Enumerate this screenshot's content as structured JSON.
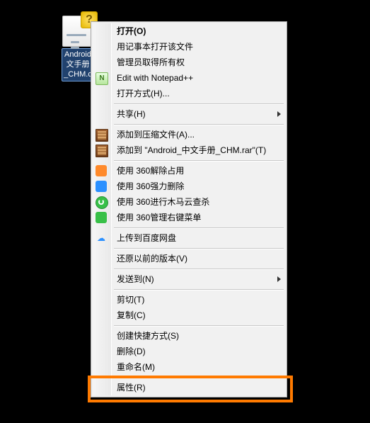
{
  "file": {
    "name_line1": "Android",
    "name_line2": "文手册",
    "name_line3": "_CHM.c"
  },
  "menu": {
    "open": "打开(O)",
    "open_notepad": "用记事本打开该文件",
    "take_ownership": "管理员取得所有权",
    "edit_npp": "Edit with Notepad++",
    "open_with": "打开方式(H)...",
    "share": "共享(H)",
    "add_to_archive": "添加到压缩文件(A)...",
    "add_to_named_rar": "添加到 \"Android_中文手册_CHM.rar\"(T)",
    "jiechu": "使用 360解除占用",
    "qiangli": "使用 360强力删除",
    "muma": "使用 360进行木马云查杀",
    "youjian": "使用 360管理右键菜单",
    "baidu": "上传到百度网盘",
    "restore_prev": "还原以前的版本(V)",
    "send_to": "发送到(N)",
    "cut": "剪切(T)",
    "copy": "复制(C)",
    "shortcut": "创建快捷方式(S)",
    "delete": "删除(D)",
    "rename": "重命名(M)",
    "properties": "属性(R)"
  }
}
